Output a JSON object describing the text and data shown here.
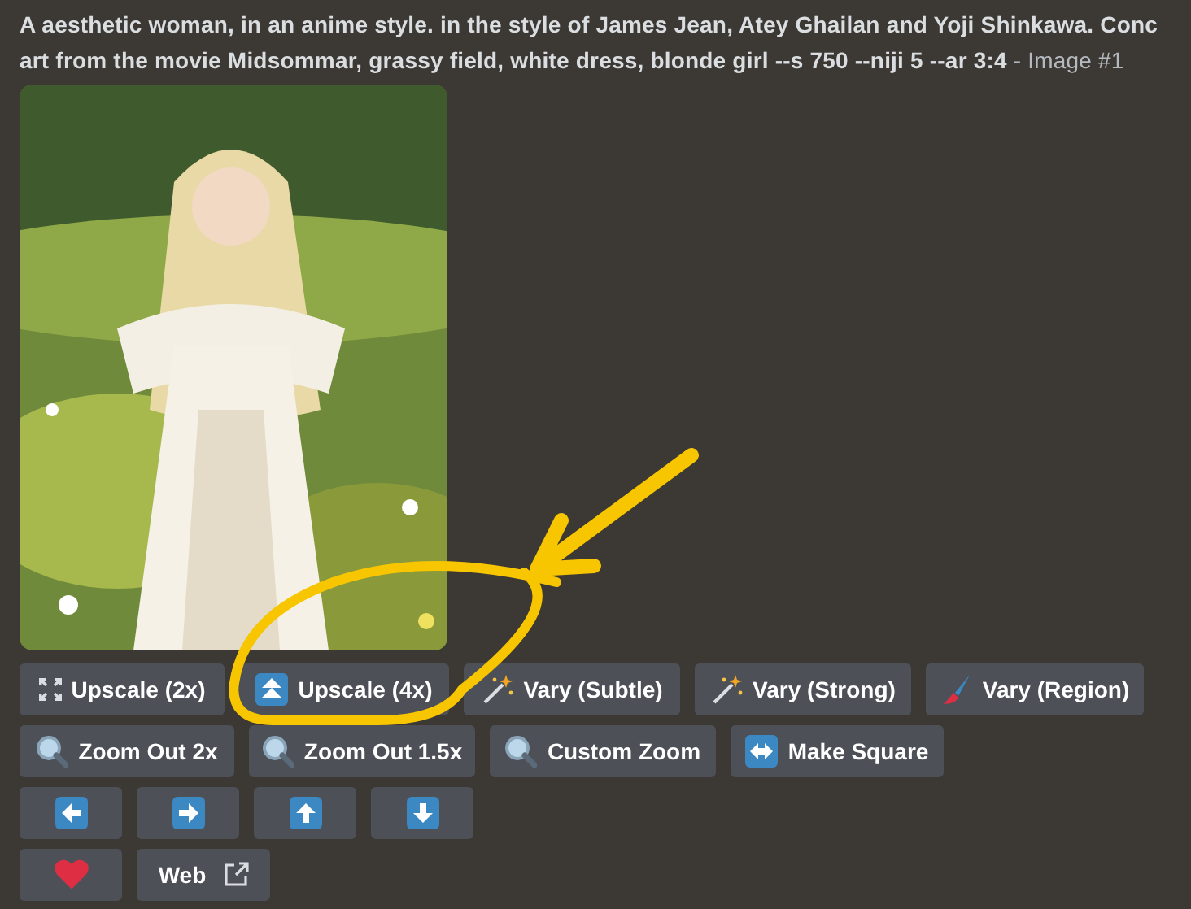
{
  "message": {
    "prompt_lines": [
      "A aesthetic woman, in an anime style. in the style of James Jean, Atey Ghailan and Yoji Shinkawa. Conc",
      "art from the movie Midsommar, grassy field, white dress, blonde girl --s 750 --niji 5 --ar 3:4"
    ],
    "suffix": " - Image #1"
  },
  "button_rows": [
    [
      {
        "label": "Upscale (2x)"
      },
      {
        "label": "Upscale (4x)"
      },
      {
        "label": "Vary (Subtle)"
      },
      {
        "label": "Vary (Strong)"
      },
      {
        "label": "Vary (Region)"
      }
    ],
    [
      {
        "label": "Zoom Out 2x"
      },
      {
        "label": "Zoom Out 1.5x"
      },
      {
        "label": "Custom Zoom"
      },
      {
        "label": "Make Square"
      }
    ],
    [
      {},
      {},
      {},
      {}
    ],
    [
      {},
      {
        "label": "Web"
      }
    ]
  ]
}
